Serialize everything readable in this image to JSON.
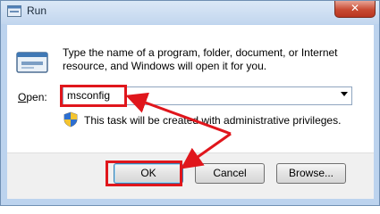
{
  "window": {
    "title": "Run",
    "close_glyph": "✕"
  },
  "dialog": {
    "instructions": "Type the name of a program, folder, document, or Internet resource, and Windows will open it for you.",
    "open_label_accel": "O",
    "open_label_rest": "pen:",
    "open_value": "msconfig",
    "admin_note": "This task will be created with administrative privileges."
  },
  "buttons": {
    "ok": "OK",
    "cancel": "Cancel",
    "browse": "Browse..."
  },
  "icons": {
    "run": "run-icon",
    "shield": "uac-shield-icon",
    "dropdown": "chevron-down-icon"
  },
  "colors": {
    "highlight": "#e0161c",
    "titlebar": "#c2d6ee",
    "close": "#c84a32"
  }
}
